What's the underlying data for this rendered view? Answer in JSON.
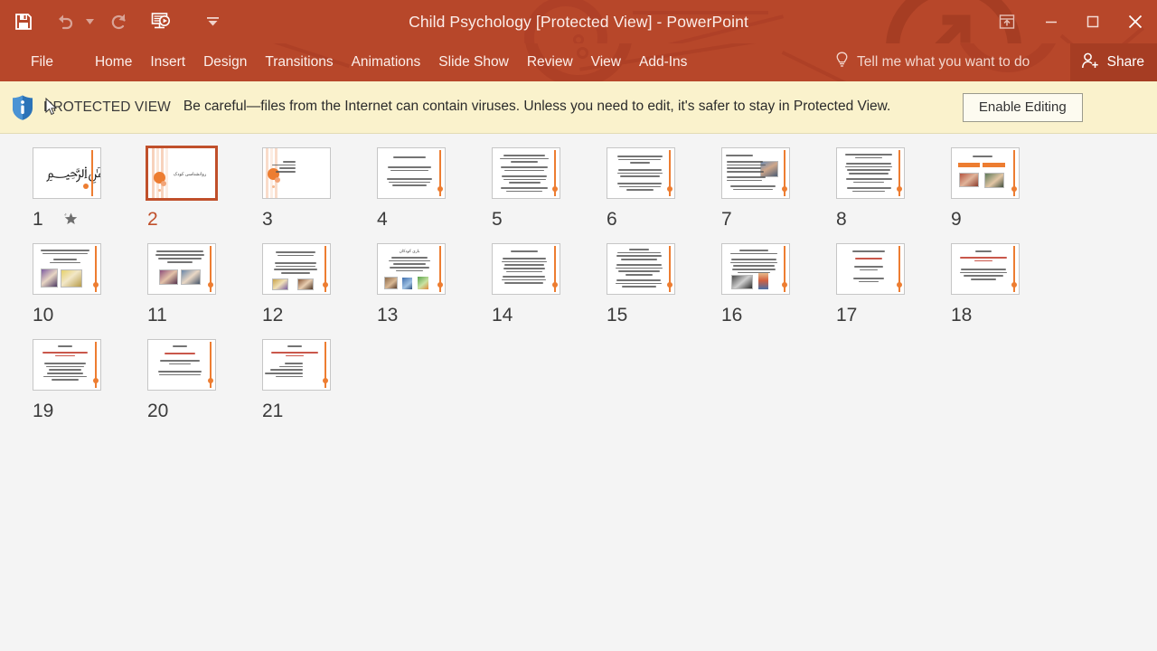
{
  "window": {
    "title": "Child Psychology [Protected View] - PowerPoint",
    "accent_color": "#B7472A",
    "controls": {
      "ribbon_display_options": "ribbon-display-options",
      "minimize": "minimize",
      "restore": "restore",
      "close": "close"
    }
  },
  "quick_access": {
    "items": [
      {
        "name": "save",
        "label": "Save"
      },
      {
        "name": "undo",
        "label": "Undo"
      },
      {
        "name": "redo",
        "label": "Repeat"
      },
      {
        "name": "start-from-beginning",
        "label": "Start From Beginning"
      },
      {
        "name": "customize-quick-access-toolbar",
        "label": "Customize Quick Access Toolbar"
      }
    ]
  },
  "ribbon": {
    "tabs": [
      {
        "label": "File"
      },
      {
        "label": "Home"
      },
      {
        "label": "Insert"
      },
      {
        "label": "Design"
      },
      {
        "label": "Transitions"
      },
      {
        "label": "Animations"
      },
      {
        "label": "Slide Show"
      },
      {
        "label": "Review"
      },
      {
        "label": "View"
      },
      {
        "label": "Add-Ins"
      }
    ],
    "tell_me": "Tell me what you want to do",
    "share": "Share"
  },
  "protected_view": {
    "badge": "PROTECTED VIEW",
    "message": "Be careful—files from the Internet can contain viruses. Unless you need to edit, it's safer to stay in Protected View.",
    "enable_button": "Enable Editing",
    "bar_color": "#FAF2CC"
  },
  "slide_sorter": {
    "selected_slide": 2,
    "slide_count": 21,
    "theme_accent": "#ED7D31",
    "slides": [
      {
        "number": "1",
        "layout": "calligraphy",
        "has_animation": true,
        "title": "",
        "lines": 0,
        "photos": 0
      },
      {
        "number": "2",
        "layout": "title",
        "has_animation": false,
        "title": "روانشناسی کودک",
        "lines": 0,
        "photos": 0
      },
      {
        "number": "3",
        "layout": "agenda",
        "has_animation": false,
        "title": "",
        "lines": 4,
        "photos": 0
      },
      {
        "number": "4",
        "layout": "text",
        "has_animation": false,
        "title": "",
        "lines": 6,
        "photos": 0
      },
      {
        "number": "5",
        "layout": "text",
        "has_animation": false,
        "title": "",
        "lines": 11,
        "photos": 0
      },
      {
        "number": "6",
        "layout": "text",
        "has_animation": false,
        "title": "",
        "lines": 9,
        "photos": 0
      },
      {
        "number": "7",
        "layout": "text-photo",
        "has_animation": false,
        "title": "",
        "lines": 10,
        "photos": 1
      },
      {
        "number": "8",
        "layout": "text",
        "has_animation": false,
        "title": "",
        "lines": 12,
        "photos": 0
      },
      {
        "number": "9",
        "layout": "bars-photos",
        "has_animation": false,
        "title": "",
        "lines": 0,
        "photos": 2
      },
      {
        "number": "10",
        "layout": "text-photos2",
        "has_animation": false,
        "title": "",
        "lines": 5,
        "photos": 2
      },
      {
        "number": "11",
        "layout": "text-photos2",
        "has_animation": false,
        "title": "",
        "lines": 4,
        "photos": 2
      },
      {
        "number": "12",
        "layout": "text-photos2",
        "has_animation": false,
        "title": "",
        "lines": 6,
        "photos": 2
      },
      {
        "number": "13",
        "layout": "title-photos3",
        "has_animation": false,
        "title": "بازی کودکان",
        "lines": 5,
        "photos": 3
      },
      {
        "number": "14",
        "layout": "text",
        "has_animation": false,
        "title": "",
        "lines": 11,
        "photos": 0
      },
      {
        "number": "15",
        "layout": "text",
        "has_animation": false,
        "title": "",
        "lines": 12,
        "photos": 0
      },
      {
        "number": "16",
        "layout": "text-photos2",
        "has_animation": false,
        "title": "",
        "lines": 7,
        "photos": 2
      },
      {
        "number": "17",
        "layout": "text-red",
        "has_animation": false,
        "title": "",
        "lines": 6,
        "photos": 0
      },
      {
        "number": "18",
        "layout": "text-red",
        "has_animation": false,
        "title": "",
        "lines": 6,
        "photos": 0
      },
      {
        "number": "19",
        "layout": "text-red",
        "has_animation": false,
        "title": "",
        "lines": 8,
        "photos": 0
      },
      {
        "number": "20",
        "layout": "text-red",
        "has_animation": false,
        "title": "",
        "lines": 6,
        "photos": 0
      },
      {
        "number": "21",
        "layout": "text-red",
        "has_animation": false,
        "title": "",
        "lines": 8,
        "photos": 0
      }
    ]
  }
}
